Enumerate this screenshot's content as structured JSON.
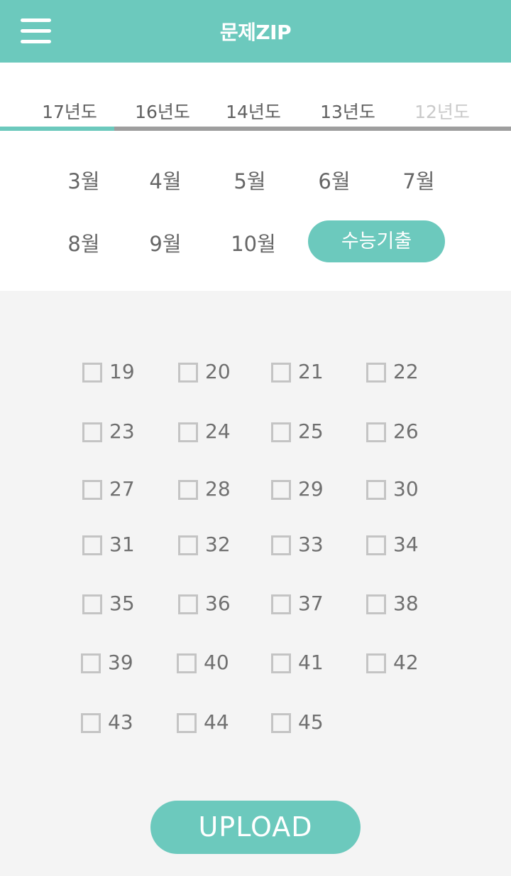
{
  "header": {
    "title": "문제ZIP",
    "menu_icon": "hamburger-menu-icon"
  },
  "years": [
    "17년도",
    "16년도",
    "14년도",
    "13년도",
    "12년도"
  ],
  "months": [
    "3월",
    "4월",
    "5월",
    "6월",
    "7월",
    "8월",
    "9월",
    "10월"
  ],
  "suneung_label": "수능기출",
  "questions": [
    "19",
    "20",
    "21",
    "22",
    "23",
    "24",
    "25",
    "26",
    "27",
    "28",
    "29",
    "30",
    "31",
    "32",
    "33",
    "34",
    "35",
    "36",
    "37",
    "38",
    "39",
    "40",
    "41",
    "42",
    "43",
    "44",
    "45"
  ],
  "upload_label": "UPLOAD",
  "colors": {
    "accent": "#6cc9bd",
    "text": "#666666",
    "muted": "#c9c9c9",
    "background": "#f4f4f4"
  }
}
